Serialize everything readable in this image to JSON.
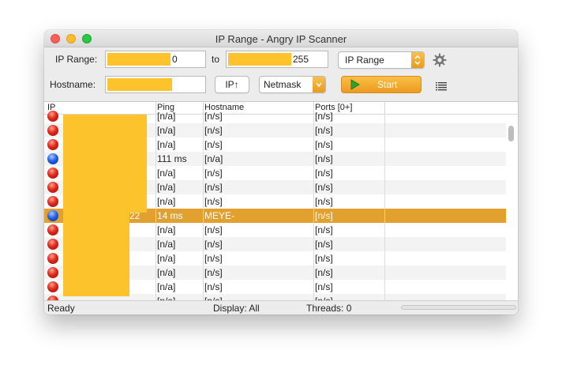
{
  "window": {
    "title": "IP Range - Angry IP Scanner"
  },
  "toolbar": {
    "ip_range_label": "IP Range:",
    "ip_from_value": "0",
    "to_label": "to",
    "ip_to_value": "255",
    "feeder_select": "IP Range",
    "hostname_label": "Hostname:",
    "ip_up_button": "IP↑",
    "netmask_select": "Netmask",
    "start_button": "Start"
  },
  "table": {
    "columns": [
      "IP",
      "Ping",
      "Hostname",
      "Ports [0+]"
    ],
    "rows": [
      {
        "status": "dead",
        "ip": "",
        "ping": "[n/a]",
        "hostname": "[n/s]",
        "ports": "[n/s]"
      },
      {
        "status": "dead",
        "ip": "",
        "ping": "[n/a]",
        "hostname": "[n/s]",
        "ports": "[n/s]"
      },
      {
        "status": "dead",
        "ip": "",
        "ping": "[n/a]",
        "hostname": "[n/s]",
        "ports": "[n/s]"
      },
      {
        "status": "alive",
        "ip": "",
        "ping": "111 ms",
        "hostname": "[n/a]",
        "ports": "[n/s]"
      },
      {
        "status": "dead",
        "ip": "",
        "ping": "[n/a]",
        "hostname": "[n/s]",
        "ports": "[n/s]"
      },
      {
        "status": "dead",
        "ip": "",
        "ping": "[n/a]",
        "hostname": "[n/s]",
        "ports": "[n/s]"
      },
      {
        "status": "dead",
        "ip": "",
        "ping": "[n/a]",
        "hostname": "[n/s]",
        "ports": "[n/s]"
      },
      {
        "status": "alive",
        "ip": "22",
        "ping": "14 ms",
        "hostname": "MEYE-",
        "ports": "[n/s]",
        "selected": true
      },
      {
        "status": "dead",
        "ip": "",
        "ping": "[n/a]",
        "hostname": "[n/s]",
        "ports": "[n/s]"
      },
      {
        "status": "dead",
        "ip": "",
        "ping": "[n/a]",
        "hostname": "[n/s]",
        "ports": "[n/s]"
      },
      {
        "status": "dead",
        "ip": "",
        "ping": "[n/a]",
        "hostname": "[n/s]",
        "ports": "[n/s]"
      },
      {
        "status": "dead",
        "ip": "",
        "ping": "[n/a]",
        "hostname": "[n/s]",
        "ports": "[n/s]"
      },
      {
        "status": "dead",
        "ip": "",
        "ping": "[n/a]",
        "hostname": "[n/s]",
        "ports": "[n/s]"
      },
      {
        "status": "dead",
        "ip": "",
        "ping": "[n/a]",
        "hostname": "[n/s]",
        "ports": "[n/s]"
      }
    ]
  },
  "status": {
    "state": "Ready",
    "display": "Display: All",
    "threads": "Threads: 0",
    "progress": 0
  },
  "icons": {
    "settings": "gear-icon",
    "list_view": "list-icon",
    "start": "play-icon",
    "status_dead": "red-dot-icon",
    "status_alive": "blue-dot-icon"
  },
  "colors": {
    "accent": "#e2a12e",
    "redaction": "#fdc32d",
    "dead": "#e02a1b",
    "alive": "#2463e6"
  }
}
